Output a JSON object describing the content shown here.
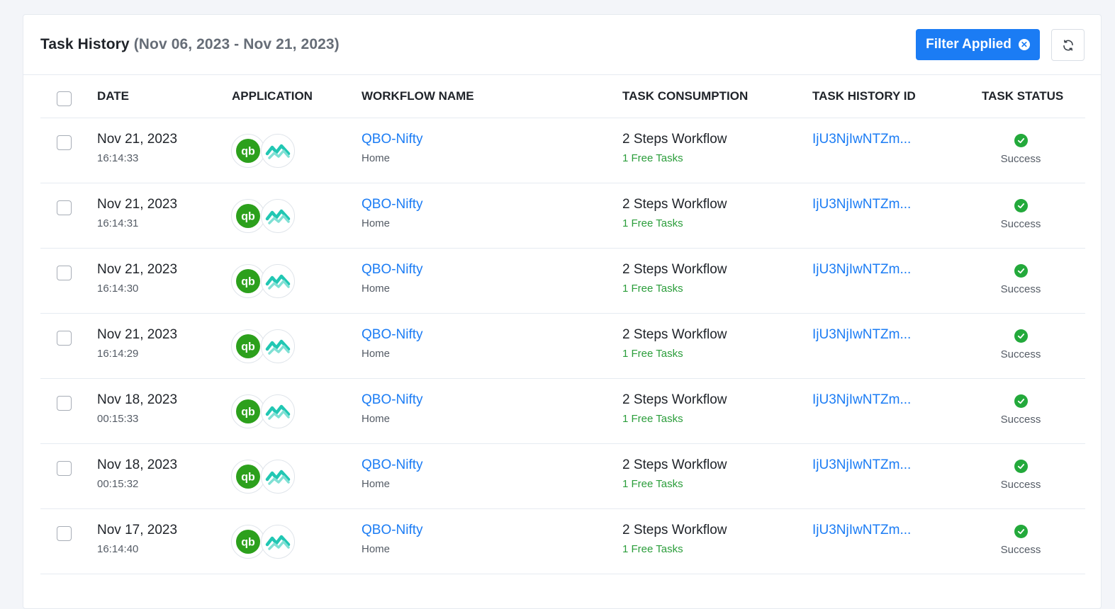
{
  "header": {
    "title": "Task History",
    "date_range": "(Nov 06, 2023 - Nov 21, 2023)",
    "filter_label": "Filter Applied"
  },
  "columns": {
    "date": "DATE",
    "application": "APPLICATION",
    "workflow": "WORKFLOW NAME",
    "consumption": "TASK CONSUMPTION",
    "history_id": "TASK HISTORY ID",
    "status": "TASK STATUS"
  },
  "colors": {
    "accent": "#1b7cf4",
    "success": "#23a93b",
    "quickbooks": "#2ca01c",
    "nifty": "#1fc4b5"
  },
  "rows": [
    {
      "date": "Nov 21, 2023",
      "time": "16:14:33",
      "apps": [
        "quickbooks-icon",
        "nifty-icon"
      ],
      "workflow": "QBO-Nifty",
      "folder": "Home",
      "consumption": "2 Steps Workflow",
      "free_tasks": "1 Free Tasks",
      "history_id": "IjU3NjIwNTZm...",
      "status": "Success"
    },
    {
      "date": "Nov 21, 2023",
      "time": "16:14:31",
      "apps": [
        "quickbooks-icon",
        "nifty-icon"
      ],
      "workflow": "QBO-Nifty",
      "folder": "Home",
      "consumption": "2 Steps Workflow",
      "free_tasks": "1 Free Tasks",
      "history_id": "IjU3NjIwNTZm...",
      "status": "Success"
    },
    {
      "date": "Nov 21, 2023",
      "time": "16:14:30",
      "apps": [
        "quickbooks-icon",
        "nifty-icon"
      ],
      "workflow": "QBO-Nifty",
      "folder": "Home",
      "consumption": "2 Steps Workflow",
      "free_tasks": "1 Free Tasks",
      "history_id": "IjU3NjIwNTZm...",
      "status": "Success"
    },
    {
      "date": "Nov 21, 2023",
      "time": "16:14:29",
      "apps": [
        "quickbooks-icon",
        "nifty-icon"
      ],
      "workflow": "QBO-Nifty",
      "folder": "Home",
      "consumption": "2 Steps Workflow",
      "free_tasks": "1 Free Tasks",
      "history_id": "IjU3NjIwNTZm...",
      "status": "Success"
    },
    {
      "date": "Nov 18, 2023",
      "time": "00:15:33",
      "apps": [
        "quickbooks-icon",
        "nifty-icon"
      ],
      "workflow": "QBO-Nifty",
      "folder": "Home",
      "consumption": "2 Steps Workflow",
      "free_tasks": "1 Free Tasks",
      "history_id": "IjU3NjIwNTZm...",
      "status": "Success"
    },
    {
      "date": "Nov 18, 2023",
      "time": "00:15:32",
      "apps": [
        "quickbooks-icon",
        "nifty-icon"
      ],
      "workflow": "QBO-Nifty",
      "folder": "Home",
      "consumption": "2 Steps Workflow",
      "free_tasks": "1 Free Tasks",
      "history_id": "IjU3NjIwNTZm...",
      "status": "Success"
    },
    {
      "date": "Nov 17, 2023",
      "time": "16:14:40",
      "apps": [
        "quickbooks-icon",
        "nifty-icon"
      ],
      "workflow": "QBO-Nifty",
      "folder": "Home",
      "consumption": "2 Steps Workflow",
      "free_tasks": "1 Free Tasks",
      "history_id": "IjU3NjIwNTZm...",
      "status": "Success"
    }
  ]
}
